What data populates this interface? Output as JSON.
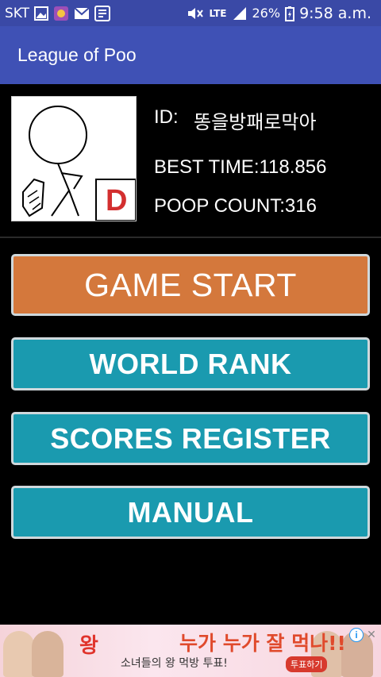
{
  "status_bar": {
    "carrier": "SKT",
    "network": "LTE",
    "battery": "26%",
    "time": "9:58 a.m."
  },
  "app_bar": {
    "title": "League of Poo"
  },
  "profile": {
    "id_label": "ID:",
    "id_value": "똥을방패로막아",
    "best_time": "BEST TIME:118.856",
    "poop_count": "POOP COUNT:316",
    "rank_letter": "D",
    "rank_color": "#d32f2f"
  },
  "menu": {
    "game_start": "GAME START",
    "world_rank": "WORLD RANK",
    "scores_register": "SCORES REGISTER",
    "manual": "MANUAL"
  },
  "ad": {
    "logo": "왕",
    "headline": "누가 누가 잘 먹나!!",
    "subline": "소녀들의 왕 먹방 투표!",
    "cta": "투표하기"
  },
  "colors": {
    "status_bar": "#3a49a6",
    "app_bar": "#3f51b5",
    "start_button": "#d4783c",
    "menu_button": "#1a9aaf"
  }
}
